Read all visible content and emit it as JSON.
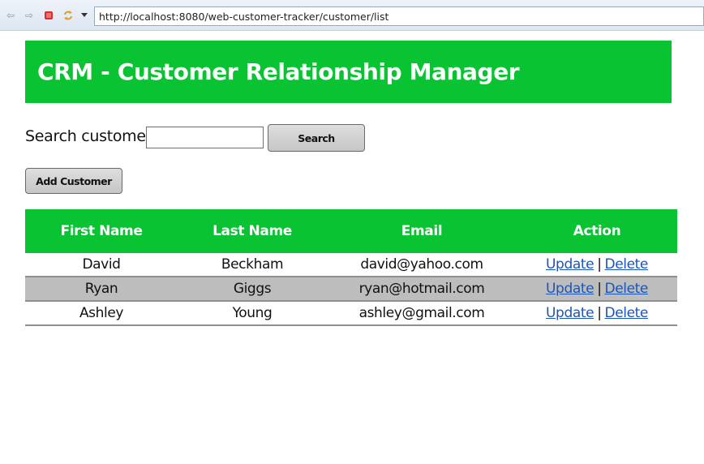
{
  "browser": {
    "url": "http://localhost:8080/web-customer-tracker/customer/list",
    "icons": [
      "back-icon",
      "forward-icon",
      "stop-icon",
      "refresh-icon",
      "dropdown-arrow-icon"
    ]
  },
  "header": {
    "title": "CRM - Customer Relationship Manager"
  },
  "search": {
    "label": "Search customer:",
    "value": "",
    "button_label": "Search"
  },
  "actions": {
    "add_label": "Add Customer"
  },
  "table": {
    "columns": [
      "First Name",
      "Last Name",
      "Email",
      "Action"
    ],
    "rows": [
      {
        "first": "David",
        "last": "Beckham",
        "email": "david@yahoo.com",
        "update": "Update",
        "delete": "Delete"
      },
      {
        "first": "Ryan",
        "last": "Giggs",
        "email": "ryan@hotmail.com",
        "update": "Update",
        "delete": "Delete"
      },
      {
        "first": "Ashley",
        "last": "Young",
        "email": "ashley@gmail.com",
        "update": "Update",
        "delete": "Delete"
      }
    ],
    "action_separator": "|"
  },
  "colors": {
    "brand_green": "#09c332",
    "link": "#1a55b8",
    "alt_row": "#bdbdbd"
  }
}
